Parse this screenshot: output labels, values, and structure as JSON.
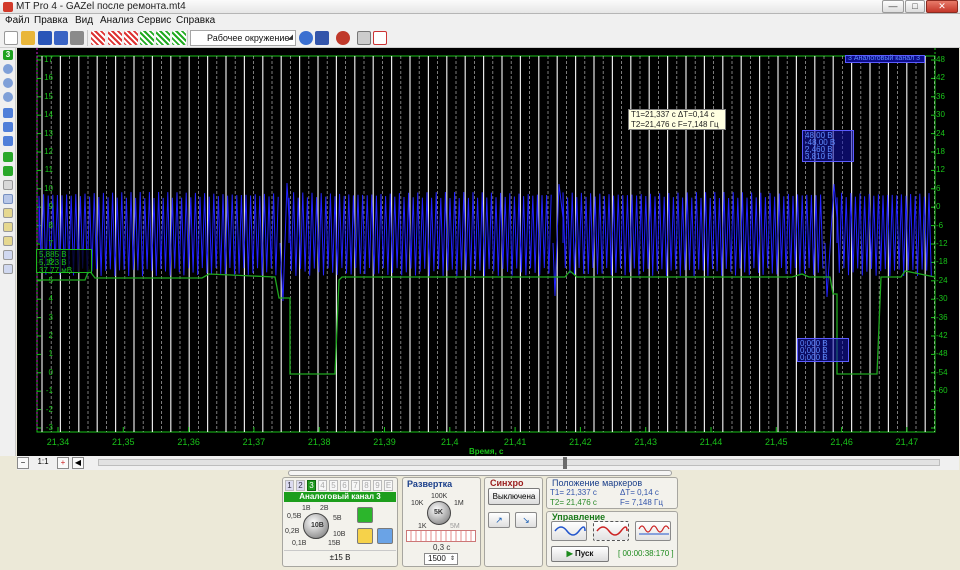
{
  "window": {
    "title": "MT Pro 4 - GAZel после ремонта.mt4",
    "min_label": "—",
    "max_label": "□",
    "close_label": "✕"
  },
  "menu": [
    "Файл",
    "Правка",
    "Вид",
    "Анализ",
    "Сервис",
    "Справка"
  ],
  "toolbar": {
    "environment_select": "Рабочее окружение"
  },
  "left_tools": {
    "channel_badge": "3"
  },
  "scope": {
    "channel_label": "3 Аналоговый канал 3",
    "y_left_ticks": [
      "17",
      "16",
      "15",
      "14",
      "13",
      "12",
      "11",
      "10",
      "9",
      "8",
      "7",
      "6",
      "5",
      "4",
      "3",
      "2",
      "1",
      "0",
      "-1",
      "-2",
      "-3"
    ],
    "y_right_ticks": [
      "48",
      "42",
      "36",
      "30",
      "24",
      "18",
      "12",
      "6",
      "0",
      "-6",
      "-12",
      "-18",
      "-24",
      "-30",
      "-36",
      "-42",
      "-48",
      "-54",
      "-60"
    ],
    "x_ticks": [
      "21,34",
      "21,35",
      "21,36",
      "21,37",
      "21,38",
      "21,39",
      "21,4",
      "21,41",
      "21,42",
      "21,43",
      "21,44",
      "21,45",
      "21,46",
      "21,47"
    ],
    "x_title": "Время, с",
    "tooltip": {
      "line1": "T1=21,337 с  ΔT=0,14 с",
      "line2": "T2=21,476 с  F=7,148 Гц"
    },
    "box_green": {
      "l1": "5,885 В",
      "l2": "5,123 В",
      "l3": "37,77 мВ"
    },
    "box_blue_top": {
      "l1": "48,00 В",
      "l2": "-48,00 В",
      "l3": "2,460 В",
      "l4": "3,810 В"
    },
    "box_blue_bottom": {
      "l1": "0,000 В",
      "l2": "0,000 В",
      "l3": "0,000 В"
    }
  },
  "zoom": {
    "ratio_label": "1:1",
    "minus": "−",
    "plus": "+",
    "left_arrow": "◀"
  },
  "channels_panel": {
    "tabs": [
      "1",
      "2",
      "3",
      "4",
      "5",
      "6",
      "7",
      "8",
      "9",
      "Е"
    ],
    "title": "Аналоговый канал 3",
    "knob_labels": [
      "0,5В",
      "1В",
      "2В",
      "5В",
      "10В",
      "15В",
      "0,2В",
      "0,1В"
    ],
    "knob_value": "10В",
    "range": "±15 В"
  },
  "sweep_panel": {
    "title": "Развертка",
    "knob_labels": [
      "10K",
      "100K",
      "1M",
      "1K",
      "5M"
    ],
    "knob_value": "5K",
    "period": "0,3 с",
    "spin_value": "1500"
  },
  "sync_panel": {
    "title": "Синхро",
    "mode": "Выключена"
  },
  "markers_panel": {
    "title": "Положение маркеров",
    "t1": "T1= 21,337 с",
    "dt": "ΔT= 0,14 с",
    "t2": "T2= 21,476 с",
    "f": "F= 7,148 Гц"
  },
  "control_panel": {
    "title": "Управление",
    "start": "Пуск",
    "timer": "[ 00:00:38:170 ]"
  },
  "colors": {
    "grid_green": "#19c219",
    "signal_blue": "#2222ff",
    "trace_green": "#1fa81f",
    "marker_magenta": "#d21fd2"
  }
}
